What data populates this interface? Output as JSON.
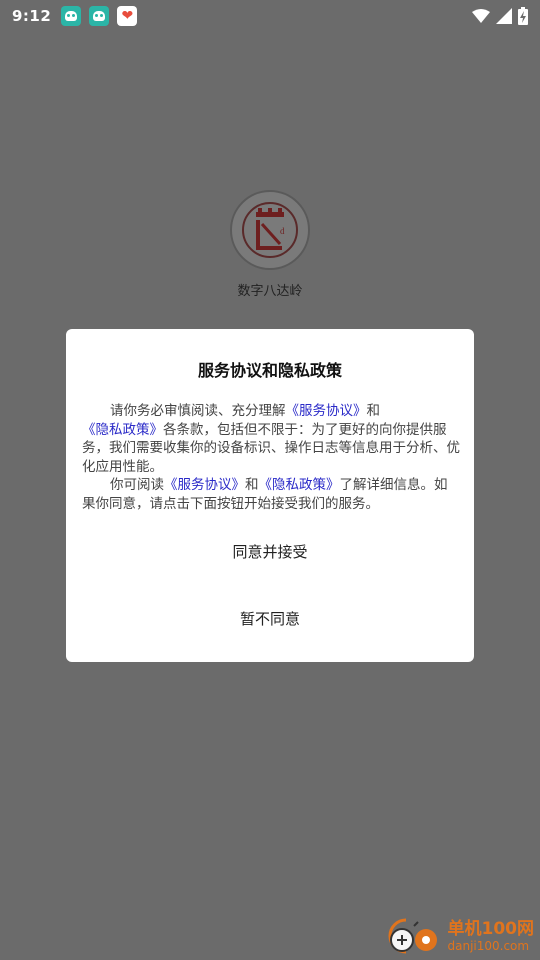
{
  "status_bar": {
    "time": "9:12",
    "notification_icons": [
      "android-app-icon",
      "android-app-icon",
      "heart-app-icon"
    ],
    "system_icons": [
      "wifi-icon",
      "signal-icon",
      "battery-charging-icon"
    ]
  },
  "app": {
    "name": "数字八达岭",
    "logo_icon": "badaling-logo-icon"
  },
  "dialog": {
    "title": "服务协议和隐私政策",
    "para1_a": "请你务必审慎阅读、充分理解",
    "para1_link1": "《服务协议》",
    "para1_b": "和",
    "para1_link2": "《隐私政策》",
    "para1_c": "各条款，包括但不限于：为了更好的向你提供服务，我们需要收集你的设备标识、操作日志等信息用于分析、优化应用性能。",
    "para2_a": "你可阅读",
    "para2_link1": "《服务协议》",
    "para2_b": "和",
    "para2_link2": "《隐私政策》",
    "para2_c": "了解详细信息。如果你同意，请点击下面按钮开始接受我们的服务。",
    "accept_label": "同意并接受",
    "decline_label": "暂不同意",
    "link_color": "#2a2ac8"
  },
  "watermark": {
    "text_cn": "单机100网",
    "text_en": "danji100.com",
    "color": "#e0741d"
  }
}
